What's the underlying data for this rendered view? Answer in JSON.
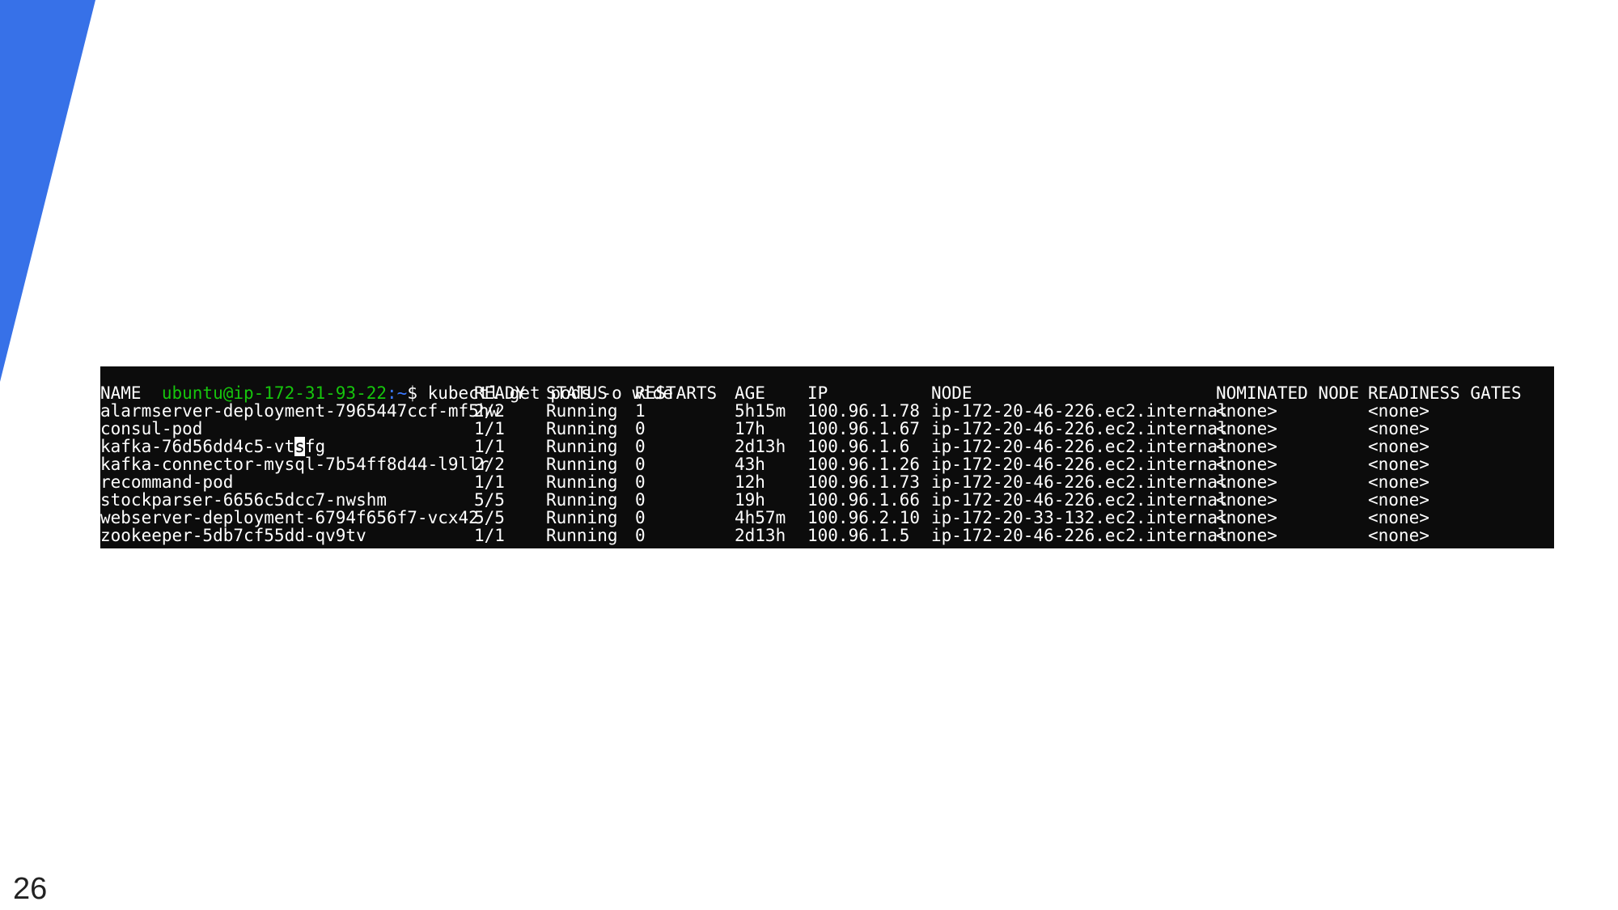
{
  "colors": {
    "accent": "#3771e8",
    "terminal_bg": "#0c0c0c",
    "prompt_user": "#16c60c",
    "prompt_path": "#3b78ff",
    "text": "#ffffff"
  },
  "prompt": {
    "user_host": "ubuntu@ip-172-31-93-22",
    "path": ":~",
    "symbol": "$",
    "command": " kubectl get pods -o wide"
  },
  "table": {
    "headers": [
      "NAME",
      "READY",
      "STATUS",
      "RESTARTS",
      "AGE",
      "IP",
      "NODE",
      "NOMINATED NODE",
      "READINESS GATES"
    ],
    "rows": [
      [
        "alarmserver-deployment-7965447ccf-mf5hw",
        "2/2",
        "Running",
        "1",
        "5h15m",
        "100.96.1.78",
        "ip-172-20-46-226.ec2.internal",
        "<none>",
        "<none>"
      ],
      [
        "consul-pod",
        "1/1",
        "Running",
        "0",
        "17h",
        "100.96.1.67",
        "ip-172-20-46-226.ec2.internal",
        "<none>",
        "<none>"
      ],
      [
        "kafka-76d56dd4c5-vtsfg",
        "1/1",
        "Running",
        "0",
        "2d13h",
        "100.96.1.6",
        "ip-172-20-46-226.ec2.internal",
        "<none>",
        "<none>"
      ],
      [
        "kafka-connector-mysql-7b54ff8d44-l9llr",
        "2/2",
        "Running",
        "0",
        "43h",
        "100.96.1.26",
        "ip-172-20-46-226.ec2.internal",
        "<none>",
        "<none>"
      ],
      [
        "recommand-pod",
        "1/1",
        "Running",
        "0",
        "12h",
        "100.96.1.73",
        "ip-172-20-46-226.ec2.internal",
        "<none>",
        "<none>"
      ],
      [
        "stockparser-6656c5dcc7-nwshm",
        "5/5",
        "Running",
        "0",
        "19h",
        "100.96.1.66",
        "ip-172-20-46-226.ec2.internal",
        "<none>",
        "<none>"
      ],
      [
        "webserver-deployment-6794f656f7-vcx42",
        "5/5",
        "Running",
        "0",
        "4h57m",
        "100.96.2.10",
        "ip-172-20-33-132.ec2.internal",
        "<none>",
        "<none>"
      ],
      [
        "zookeeper-5db7cf55dd-qv9tv",
        "1/1",
        "Running",
        "0",
        "2d13h",
        "100.96.1.5",
        "ip-172-20-46-226.ec2.internal",
        "<none>",
        "<none>"
      ]
    ]
  },
  "cursor": {
    "row": 2,
    "char_index": 19
  },
  "footer": {
    "page_number": "26"
  }
}
